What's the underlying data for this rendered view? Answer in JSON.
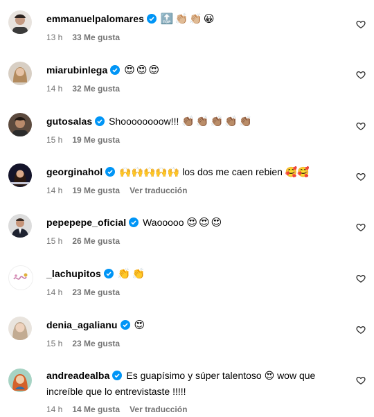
{
  "comments": [
    {
      "username": "emmanuelpalomares",
      "text": "",
      "emoji": "🔝👏🏼👏🏼😀",
      "time": "13 h",
      "likes": "33 Me gusta",
      "translate": "",
      "avatar_color": "#4a3b32"
    },
    {
      "username": "miarubinlega",
      "text": "",
      "emoji": "😍😍😍",
      "time": "14 h",
      "likes": "32 Me gusta",
      "translate": "",
      "avatar_color": "#c4a07a"
    },
    {
      "username": "gutosalas",
      "text": "Shoooooooow!!!",
      "emoji": "👏🏽👏🏽👏🏽👏🏽👏🏽",
      "time": "15 h",
      "likes": "19 Me gusta",
      "translate": "",
      "avatar_color": "#3a2b22"
    },
    {
      "username": "georginahol",
      "text": "🙌🙌🙌🙌🙌 los dos me caen rebien 🥰🥰",
      "emoji": "",
      "time": "14 h",
      "likes": "19 Me gusta",
      "translate": "Ver traducción",
      "avatar_color": "#1b1b2e"
    },
    {
      "username": "pepepepe_oficial",
      "text": "Waooooo",
      "emoji": "😍😍😍",
      "time": "15 h",
      "likes": "26 Me gusta",
      "translate": "",
      "avatar_color": "#6b6b6b"
    },
    {
      "username": "_lachupitos",
      "text": "",
      "emoji": "👏👏",
      "time": "14 h",
      "likes": "23 Me gusta",
      "translate": "",
      "avatar_color": "#f4e9f0"
    },
    {
      "username": "denia_agalianu",
      "text": "",
      "emoji": "😍",
      "time": "15 h",
      "likes": "23 Me gusta",
      "translate": "",
      "avatar_color": "#b9a38e"
    },
    {
      "username": "andreadealba",
      "text": "Es guapísimo y súper talentoso 😍 wow que increíble que lo entrevistaste !!!!!",
      "emoji": "",
      "time": "14 h",
      "likes": "14 Me gusta",
      "translate": "Ver traducción",
      "avatar_color": "#d07a3a"
    }
  ],
  "colors": {
    "verified": "#0095f6",
    "meta": "#737373"
  },
  "icons": {
    "verified": "verified-badge-icon",
    "like": "heart-outline-icon"
  }
}
